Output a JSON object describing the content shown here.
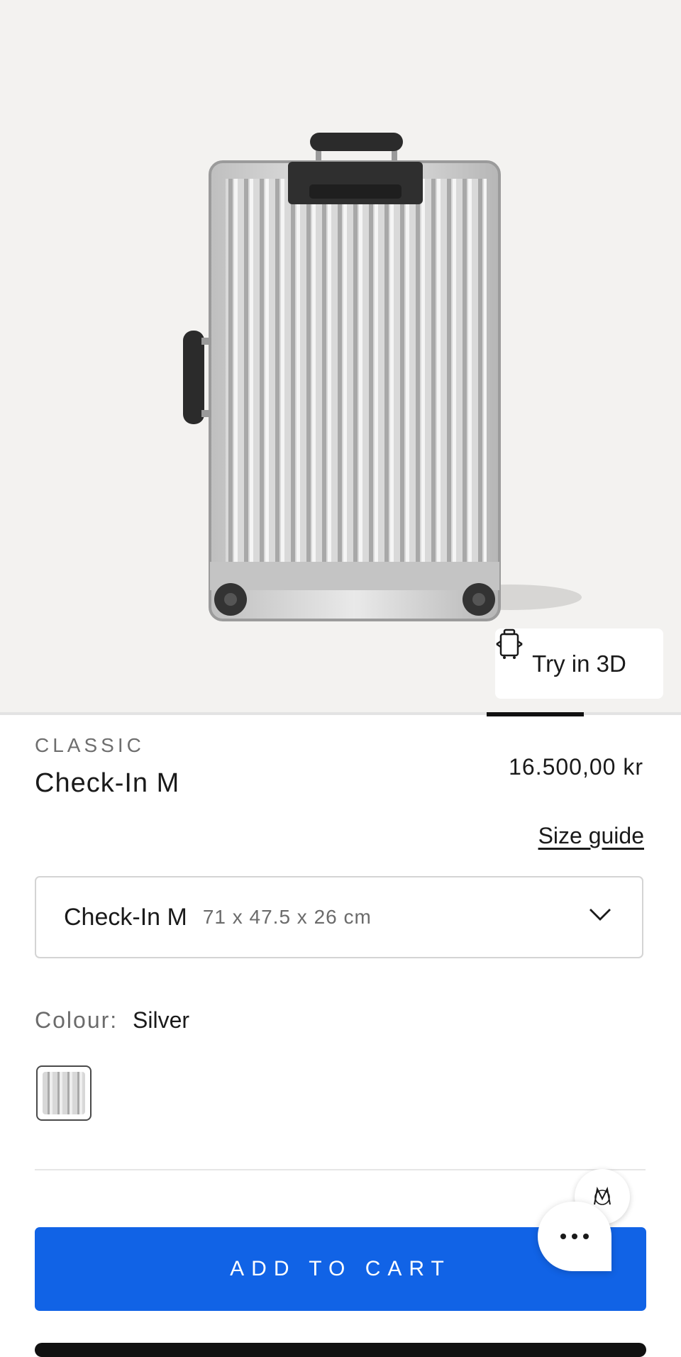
{
  "gallery": {
    "try3d_label": "Try in 3D",
    "try3d_icon": "suitcase-3d-icon",
    "slide_progress": {
      "current": 6,
      "total": 7
    }
  },
  "product": {
    "collection": "CLASSIC",
    "name": "Check-In M",
    "price": "16.500,00 kr"
  },
  "size": {
    "guide_label": "Size guide",
    "selected_name": "Check-In M",
    "selected_dims": "71 x 47.5 x 26 cm",
    "icon": "chevron-down-icon"
  },
  "colour": {
    "label": "Colour:",
    "value": "Silver",
    "swatch_icon": "silver-swatch"
  },
  "cart": {
    "button_label": "ADD TO CART"
  },
  "chat": {
    "icon": "chat-bubble-icon",
    "assistant_icon": "brand-monogram-icon"
  },
  "colors": {
    "cart_button": "#1163e6",
    "hero_background": "#f3f2f0"
  }
}
